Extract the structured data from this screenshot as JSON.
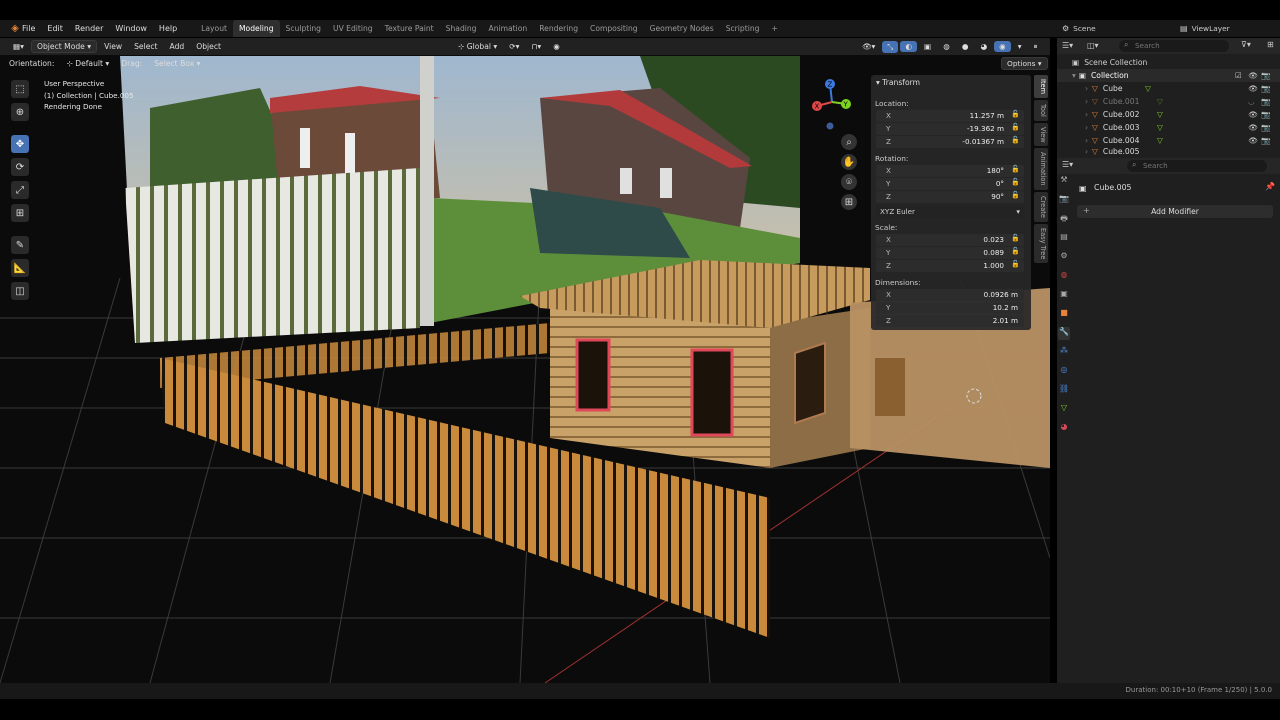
{
  "menu": [
    "File",
    "Edit",
    "Render",
    "Window",
    "Help"
  ],
  "workspaces": [
    "Layout",
    "Modeling",
    "Sculpting",
    "UV Editing",
    "Texture Paint",
    "Shading",
    "Animation",
    "Rendering",
    "Compositing",
    "Geometry Nodes",
    "Scripting"
  ],
  "active_workspace": "Modeling",
  "add_workspace": "+",
  "scene": "Scene",
  "viewlayer": "ViewLayer",
  "header": {
    "mode": "Object Mode",
    "view": "View",
    "select": "Select",
    "add": "Add",
    "object": "Object",
    "transform_space": "Global",
    "options": "Options"
  },
  "header2": {
    "orientation_label": "Orientation:",
    "orientation": "Default",
    "drag_label": "Drag:",
    "drag": "Select Box"
  },
  "viewport_info": {
    "line1": "User Perspective",
    "line2": "(1) Collection | Cube.005",
    "line3": "Rendering Done"
  },
  "npanel": {
    "title": "Transform",
    "location_label": "Location:",
    "location": {
      "x": "11.257 m",
      "y": "-19.362 m",
      "z": "-0.01367 m"
    },
    "rotation_label": "Rotation:",
    "rotation": {
      "x": "180°",
      "y": "0°",
      "z": "90°"
    },
    "rotation_mode": "XYZ Euler",
    "scale_label": "Scale:",
    "scale": {
      "x": "0.023",
      "y": "0.089",
      "z": "1.000"
    },
    "dimensions_label": "Dimensions:",
    "dimensions": {
      "x": "0.0926 m",
      "y": "10.2 m",
      "z": "2.01 m"
    }
  },
  "axes": [
    "X",
    "Y",
    "Z"
  ],
  "sidetabs": [
    "Item",
    "Tool",
    "View",
    "Animation",
    "Create",
    "Easy Tree"
  ],
  "outliner": {
    "search_placeholder": "Search",
    "root": "Scene Collection",
    "collection": "Collection",
    "items": [
      "Cube",
      "Cube.001",
      "Cube.002",
      "Cube.003",
      "Cube.004",
      "Cube.005"
    ]
  },
  "properties": {
    "search_placeholder": "Search",
    "object": "Cube.005",
    "add_modifier": "Add Modifier"
  },
  "status": "Duration: 00:10+10 (Frame 1/250) | 5.0.0",
  "colors": {
    "accent": "#4772b3",
    "gizmo_x": "#e04848",
    "gizmo_y": "#7ed321",
    "gizmo_z": "#3d7ae0",
    "outline": "#e8485a"
  }
}
